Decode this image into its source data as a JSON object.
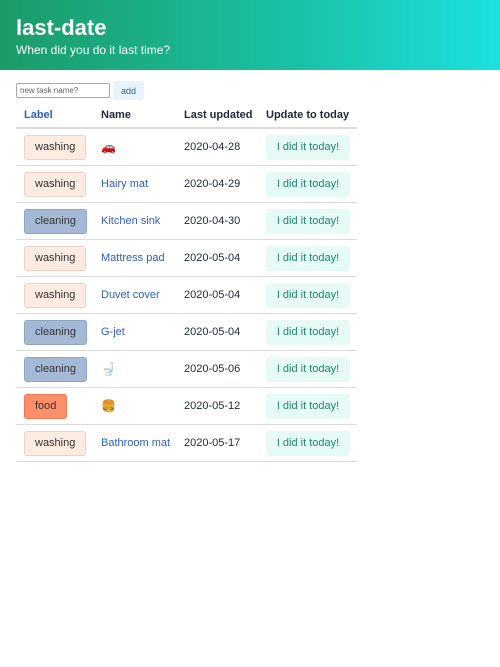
{
  "header": {
    "title": "last-date",
    "subtitle": "When did you do it last time?"
  },
  "add_form": {
    "placeholder": "new task name?",
    "button_label": "add"
  },
  "table": {
    "columns": [
      "Label",
      "Name",
      "Last updated",
      "Update to today"
    ],
    "rows": [
      {
        "label": "washing",
        "label_type": "washing",
        "name": "🚗",
        "is_emoji": true,
        "date": "2020-04-28",
        "action": "I did it today!"
      },
      {
        "label": "washing",
        "label_type": "washing",
        "name": "Hairy mat",
        "is_emoji": false,
        "date": "2020-04-29",
        "action": "I did it today!"
      },
      {
        "label": "cleaning",
        "label_type": "cleaning",
        "name": "Kitchen sink",
        "is_emoji": false,
        "date": "2020-04-30",
        "action": "I did it today!"
      },
      {
        "label": "washing",
        "label_type": "washing",
        "name": "Mattress pad",
        "is_emoji": false,
        "date": "2020-05-04",
        "action": "I did it today!"
      },
      {
        "label": "washing",
        "label_type": "washing",
        "name": "Duvet cover",
        "is_emoji": false,
        "date": "2020-05-04",
        "action": "I did it today!"
      },
      {
        "label": "cleaning",
        "label_type": "cleaning",
        "name": "G-jet",
        "is_emoji": false,
        "date": "2020-05-04",
        "action": "I did it today!"
      },
      {
        "label": "cleaning",
        "label_type": "cleaning",
        "name": "🚽",
        "is_emoji": true,
        "date": "2020-05-06",
        "action": "I did it today!"
      },
      {
        "label": "food",
        "label_type": "food",
        "name": "🍔",
        "is_emoji": true,
        "date": "2020-05-12",
        "action": "I did it today!"
      },
      {
        "label": "washing",
        "label_type": "washing",
        "name": "Bathroom mat",
        "is_emoji": false,
        "date": "2020-05-17",
        "action": "I did it today!"
      }
    ]
  },
  "colors": {
    "gradient_start": "#1c9b68",
    "gradient_end": "#1de0e0",
    "link": "#2f5fc2",
    "washing_tag": "#fbebe0",
    "cleaning_tag": "#a4b9d6",
    "food_tag": "#ff8f6b",
    "action_button_bg": "#e6fbf6",
    "action_button_text": "#1b8a6c"
  }
}
